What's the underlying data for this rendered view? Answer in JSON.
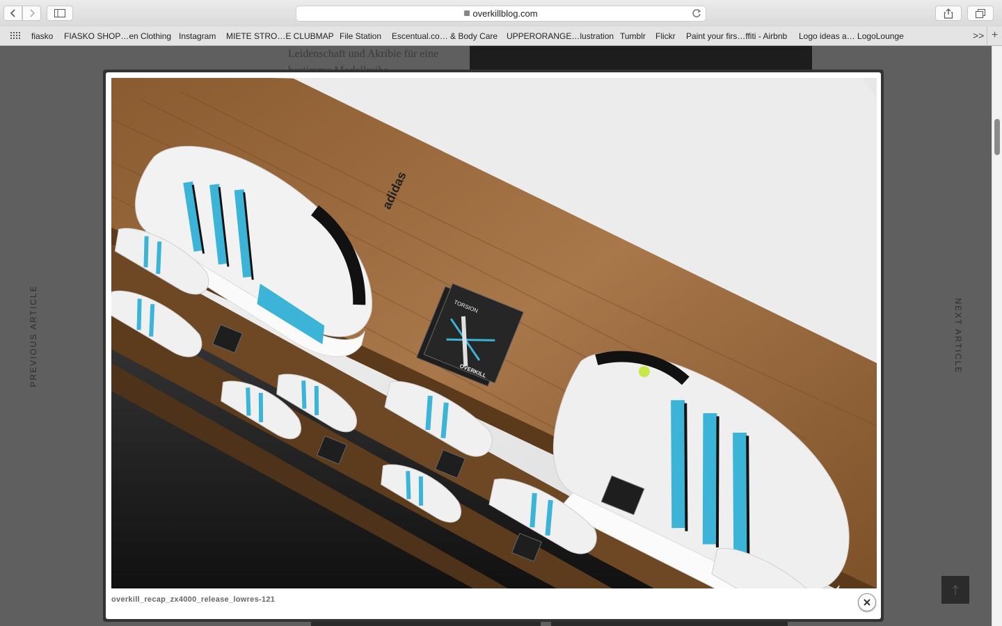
{
  "browser": {
    "url": "overkillblog.com",
    "bookmarks": [
      "fiasko",
      "FIASKO SHOP…en Clothing",
      "Instagram",
      "MIETE STRO…E CLUBMAP",
      "File Station",
      "Escentual.co… & Body Care",
      "UPPERORANGE…lustration",
      "Tumblr",
      "Flickr",
      "Paint your firs…ffiti - Airbnb",
      "Logo ideas a… LogoLounge"
    ],
    "more_label": ">>"
  },
  "page": {
    "article_text": "Leidenschaft und Akribie für eine bestimme Modellreihe",
    "prev_label": "PREVIOUS ARTICLE",
    "next_label": "NEXT ARTICLE"
  },
  "lightbox": {
    "caption": "overkill_recap_zx4000_release_lowres-121",
    "photo_text": {
      "brand": "adidas",
      "sticker_brand": "OVERKILL",
      "sticker_model": "TORSION"
    }
  },
  "colors": {
    "accent_blue": "#3bb4d8",
    "wood": "#9a6a3c",
    "overlay_bg": "#5f5f5f"
  }
}
